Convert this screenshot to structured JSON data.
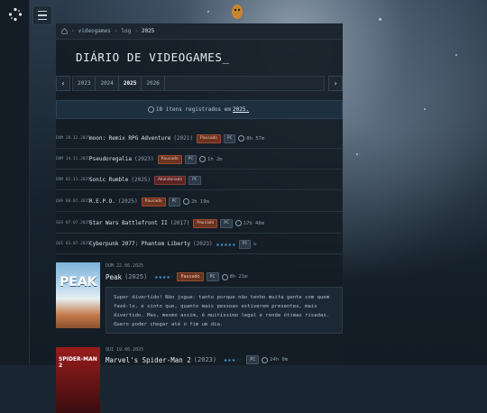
{
  "breadcrumb": {
    "home_icon": "home-icon",
    "items": [
      "videogames",
      "log",
      "2025"
    ]
  },
  "page_title": "DIÁRIO DE VIDEOGAMES_",
  "year_nav": {
    "prev_icon": "chevron-left-icon",
    "next_icon": "chevron-right-icon",
    "years": [
      "2023",
      "2024",
      "2025",
      "2026"
    ],
    "active": "2025"
  },
  "counter": {
    "icon": "clock-icon",
    "prefix": "18 itens registrados em",
    "year": "2025."
  },
  "entries": [
    {
      "date": "DOM 28.12.2025",
      "title": "moon: Remix RPG Adventure",
      "year": "(2021)",
      "status": "Pausado",
      "platform": "PC",
      "hours": "8h 57m"
    },
    {
      "date": "DOM 14.11.2025",
      "title": "Pseudoregalia",
      "year": "(2023)",
      "status": "Pausado",
      "platform": "PC",
      "hours": "1h 2m"
    },
    {
      "date": "DOM 02.11.2025",
      "title": "Sonic Rumble",
      "year": "(2025)",
      "status": "Abandonado",
      "platform": "PC",
      "hours": ""
    },
    {
      "date": "QUA 08.07.2025",
      "title": "R.E.P.O.",
      "year": "(2025)",
      "status": "Pausado",
      "platform": "PC",
      "hours": "2h 19m"
    },
    {
      "date": "SEX 07.07.2025",
      "title": "Star Wars Battlefront II",
      "year": "(2017)",
      "status": "Pausado",
      "platform": "PC",
      "hours": "17h 40m"
    },
    {
      "date": "QUI 03.07.2025",
      "title": "Cyberpunk 2077: Phantom Liberty",
      "year": "(2023)",
      "rating": 5,
      "platform": "PC",
      "replay_icon": "replay-icon"
    }
  ],
  "featured": [
    {
      "date": "DOM 22.06.2025",
      "title": "Peak",
      "year": "(2025)",
      "rating": 4,
      "status": "Pausado",
      "platform": "PC",
      "hours": "8h 21m",
      "cover_text": "PEAK",
      "review": "Super divertido! Não jogue: tanto porque não tenho muita gente com quem fazê-lo, e sinto que, quanto mais pessoas estiverem presentes, mais divertido. Mas, mesmo assim, é muitíssimo legal e rende ótimas risadas. Quero poder chegar até o fim um dia."
    },
    {
      "date": "QUI 19.06.2025",
      "title": "Marvel's Spider-Man 2",
      "year": "(2023)",
      "rating": 3,
      "platform": "PC",
      "hours": "24h 0m",
      "cover_text": "SPIDER-MAN 2"
    }
  ],
  "colors": {
    "accent": "#4aa9e8",
    "paused": "#6b3221",
    "panel": "#141d26"
  }
}
